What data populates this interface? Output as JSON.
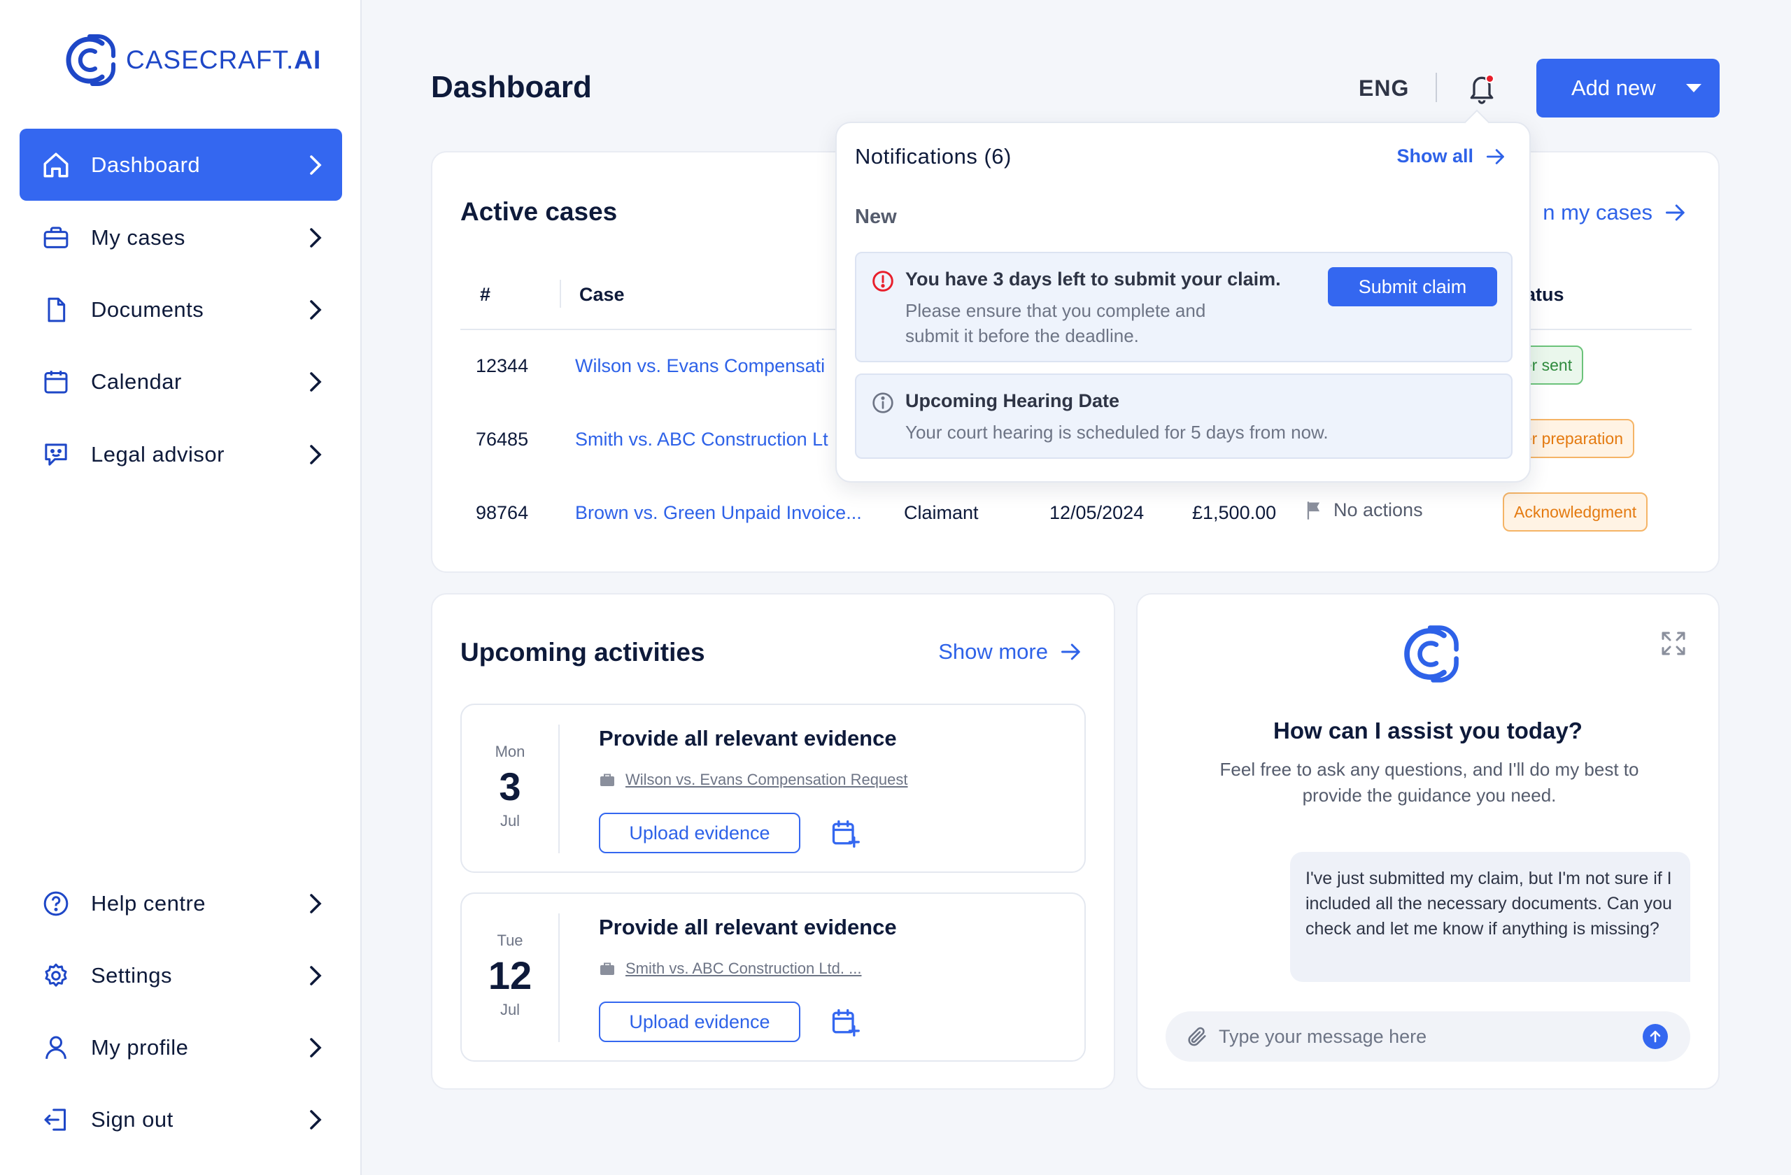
{
  "brand": {
    "name_prefix": "CASECRAFT.",
    "name_suffix": "AI"
  },
  "sidebar": {
    "items": [
      {
        "label": "Dashboard",
        "icon": "home-icon",
        "active": true
      },
      {
        "label": "My cases",
        "icon": "briefcase-icon"
      },
      {
        "label": "Documents",
        "icon": "document-icon"
      },
      {
        "label": "Calendar",
        "icon": "calendar-icon"
      },
      {
        "label": "Legal advisor",
        "icon": "chat-bot-icon"
      }
    ],
    "bottom_items": [
      {
        "label": "Help centre",
        "icon": "help-icon"
      },
      {
        "label": "Settings",
        "icon": "gear-icon"
      },
      {
        "label": "My profile",
        "icon": "user-icon"
      },
      {
        "label": "Sign out",
        "icon": "sign-out-icon"
      }
    ]
  },
  "header": {
    "title": "Dashboard",
    "language": "ENG",
    "add_new_label": "Add new"
  },
  "active_cases": {
    "title": "Active cases",
    "view_all_label": "n my cases",
    "columns": {
      "num": "#",
      "case": "Case",
      "status": "atus"
    },
    "rows": [
      {
        "id": "12344",
        "case": "Wilson vs. Evans Compensati",
        "status": "tter sent",
        "status_color": "green"
      },
      {
        "id": "76485",
        "case": "Smith vs. ABC Construction Lt",
        "status": "tter preparation",
        "status_color": "orange"
      },
      {
        "id": "98764",
        "case": "Brown vs. Green Unpaid Invoice...",
        "role": "Claimant",
        "date": "12/05/2024",
        "amount": "£1,500.00",
        "actions": "No actions",
        "status": "Acknowledgment",
        "status_color": "orange"
      }
    ]
  },
  "notifications": {
    "title": "Notifications (6)",
    "show_all_label": "Show all",
    "section_label": "New",
    "items": [
      {
        "title": "You have 3 days left to submit your claim.",
        "text_line1": "Please ensure that you complete and",
        "text_line2": "submit it before the deadline.",
        "button": "Submit claim",
        "icon": "alert-circle-icon"
      },
      {
        "title": "Upcoming Hearing Date",
        "text_line1": "Your court hearing is scheduled for 5 days from now.",
        "icon": "info-circle-icon"
      }
    ]
  },
  "activities": {
    "title": "Upcoming activities",
    "show_more_label": "Show more",
    "items": [
      {
        "dow": "Mon",
        "day": "3",
        "month": "Jul",
        "title": "Provide all relevant evidence",
        "case": "Wilson vs. Evans Compensation Request",
        "button": "Upload evidence"
      },
      {
        "dow": "Tue",
        "day": "12",
        "month": "Jul",
        "title": "Provide all relevant evidence",
        "case": "Smith vs. ABC Construction Ltd. ...",
        "button": "Upload evidence"
      }
    ]
  },
  "assistant": {
    "heading": "How can I assist you today?",
    "subtext_line1": "Feel free to ask any questions, and I'll do my best to",
    "subtext_line2": "provide the guidance you need.",
    "message": "I've just submitted my claim, but I'm not sure if I included all the necessary documents. Can you check and let me know if anything is missing?",
    "input_placeholder": "Type your message here"
  },
  "colors": {
    "accent": "#3467F0",
    "link": "#2E62E8",
    "text": "#0E1A3A",
    "alert": "#E81E2B"
  }
}
